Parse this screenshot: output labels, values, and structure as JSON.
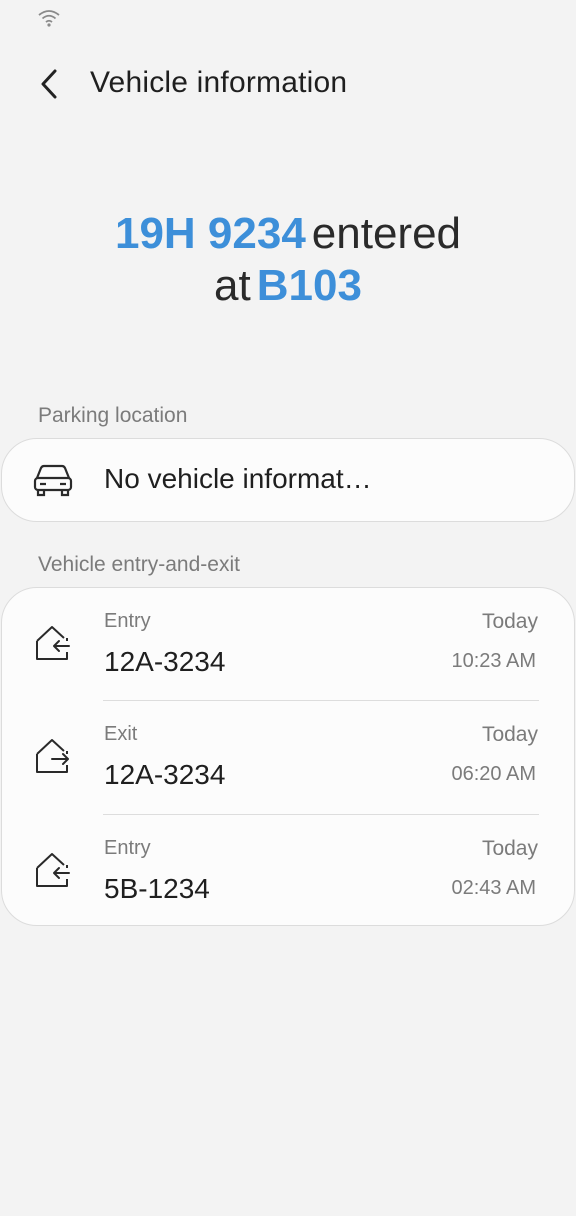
{
  "app_bar": {
    "title": "Vehicle information"
  },
  "headline": {
    "plate": "19H 9234",
    "verb": "entered",
    "prep": "at",
    "location": "B103"
  },
  "parking": {
    "section_label": "Parking location",
    "text": "No vehicle informat…",
    "icon": "car-icon"
  },
  "entries": {
    "section_label": "Vehicle entry-and-exit",
    "rows": [
      {
        "type": "Entry",
        "plate": "12A-3234",
        "day": "Today",
        "time": "10:23 AM",
        "icon": "entry-icon"
      },
      {
        "type": "Exit",
        "plate": "12A-3234",
        "day": "Today",
        "time": "06:20 AM",
        "icon": "exit-icon"
      },
      {
        "type": "Entry",
        "plate": "5B-1234",
        "day": "Today",
        "time": "02:43 AM",
        "icon": "entry-icon"
      }
    ]
  },
  "colors": {
    "accent": "#3d8fd9",
    "background": "#f3f3f3",
    "card": "#fcfcfc"
  }
}
